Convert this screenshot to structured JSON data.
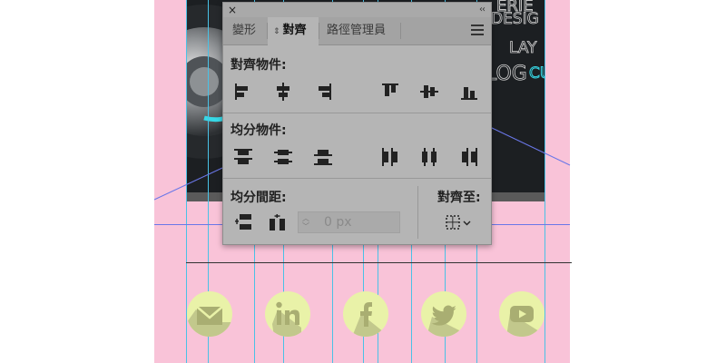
{
  "panel": {
    "close_glyph": "×",
    "collapse_glyph": "‹‹",
    "tabs": [
      {
        "label": "變形"
      },
      {
        "label": "對齊",
        "active": true
      },
      {
        "label": "路徑管理員"
      }
    ],
    "sections": {
      "align_objects": "對齊物件:",
      "distribute_objects": "均分物件:",
      "distribute_spacing": "均分間距:",
      "align_to": "對齊至:"
    },
    "spacing_field": {
      "value": "0 px"
    }
  },
  "artwork": {
    "photo_text": [
      "ERIE",
      "DESIG",
      "LAY",
      "LOG",
      "CUS"
    ],
    "social_icons": [
      "mail-icon",
      "linkedin-icon",
      "facebook-icon",
      "twitter-icon",
      "youtube-icon"
    ],
    "icon_circle_color": "#e9f2a8",
    "icon_glyph_color": "#a9ae72",
    "artboard_color": "#f9c3d8",
    "guide_color": "#49c2e6"
  }
}
